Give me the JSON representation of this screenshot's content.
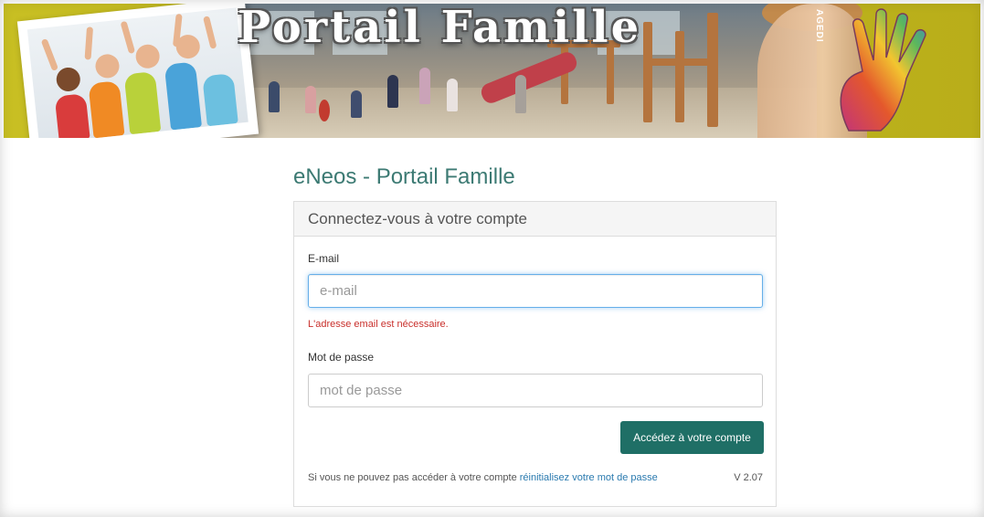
{
  "banner": {
    "title": "Portail Famille",
    "vendor_mark": "AGEDI",
    "accent_color": "#c2b720"
  },
  "page": {
    "heading": "eNeos - Portail Famille"
  },
  "login_panel": {
    "title": "Connectez-vous à votre compte",
    "email_label": "E-mail",
    "email_placeholder": "e-mail",
    "email_value": "",
    "email_error": "L'adresse email est nécessaire.",
    "password_label": "Mot de passe",
    "password_placeholder": "mot de passe",
    "password_value": "",
    "submit_label": "Accédez à votre compte",
    "help_text": "Si vous ne pouvez pas accéder à votre compte",
    "reset_link": "réinitialisez votre mot de passe",
    "version": "V 2.07"
  },
  "colors": {
    "heading": "#3c7a73",
    "button": "#1f6f66",
    "error": "#c9302c",
    "link": "#2a7aaf",
    "focus_border": "#66afe9"
  }
}
